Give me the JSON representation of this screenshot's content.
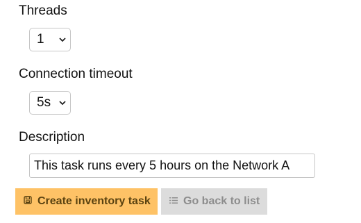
{
  "form": {
    "threads": {
      "label": "Threads",
      "value": "1"
    },
    "timeout": {
      "label": "Connection timeout",
      "value": "5s"
    },
    "description": {
      "label": "Description",
      "value": "This task runs every 5 hours on the Network A"
    }
  },
  "actions": {
    "create_label": "Create inventory task",
    "create_icon": "save-icon",
    "back_label": "Go back to list",
    "back_icon": "list-icon"
  },
  "colors": {
    "primary_button": "#fec266",
    "secondary_button": "#dcdcdc"
  }
}
